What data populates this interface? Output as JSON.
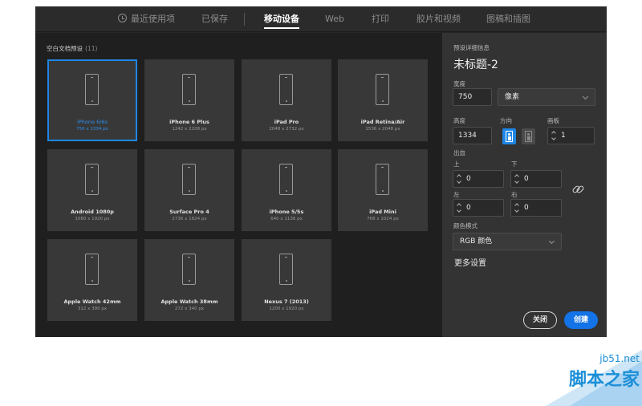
{
  "tabs": [
    {
      "label": "最近使用项",
      "icon": "clock-icon"
    },
    {
      "label": "已保存"
    },
    {
      "label": "移动设备",
      "active": true
    },
    {
      "label": "Web"
    },
    {
      "label": "打印"
    },
    {
      "label": "胶片和视频"
    },
    {
      "label": "图稿和插图"
    }
  ],
  "presets": {
    "title": "空白文档预设",
    "count": "(11)",
    "cards": [
      {
        "name": "iPhone 6/6s",
        "size": "750 x 1334 px",
        "selected": true
      },
      {
        "name": "iPhone 6 Plus",
        "size": "1242 x 2208 px"
      },
      {
        "name": "iPad Pro",
        "size": "2048 x 2732 px"
      },
      {
        "name": "iPad Retina/Air",
        "size": "1536 x 2048 px"
      },
      {
        "name": "Android 1080p",
        "size": "1080 x 1920 px"
      },
      {
        "name": "Surface Pro 4",
        "size": "2736 x 1824 px"
      },
      {
        "name": "iPhone 5/5s",
        "size": "640 x 1136 px"
      },
      {
        "name": "iPad Mini",
        "size": "768 x 1024 px"
      },
      {
        "name": "Apple Watch 42mm",
        "size": "312 x 390 px"
      },
      {
        "name": "Apple Watch 38mm",
        "size": "272 x 340 px"
      },
      {
        "name": "Nexus 7 (2013)",
        "size": "1200 x 1920 px"
      }
    ]
  },
  "details": {
    "heading": "预设详细信息",
    "doc_title": "未标题-2",
    "width_label": "宽度",
    "width_value": "750",
    "unit_value": "像素",
    "height_label": "高度",
    "height_value": "1334",
    "orientation_label": "方向",
    "artboards_label": "画板",
    "artboards_value": "1",
    "bleed_label": "出血",
    "top_label": "上",
    "top_value": "0",
    "bottom_label": "下",
    "bottom_value": "0",
    "left_label": "左",
    "left_value": "0",
    "right_label": "右",
    "right_value": "0",
    "color_mode_label": "颜色模式",
    "color_mode_value": "RGB 颜色",
    "more_settings": "更多设置",
    "close_label": "关闭",
    "create_label": "创建"
  },
  "watermark": {
    "url": "jb51.net",
    "name": "脚本之家"
  },
  "colors": {
    "accent": "#1e86e5",
    "create_button": "#1473e6",
    "watermark": "#1b8fd8"
  }
}
